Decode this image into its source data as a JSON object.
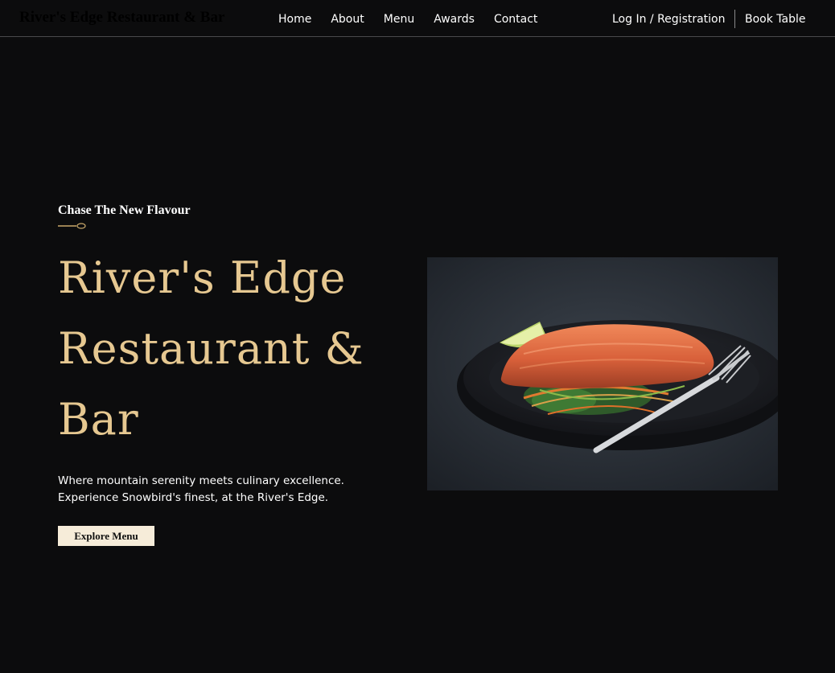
{
  "header": {
    "brand": "River's Edge Restaurant & Bar",
    "nav": [
      "Home",
      "About",
      "Menu",
      "Awards",
      "Contact"
    ],
    "login_label": "Log In / Registration",
    "book_label": "Book Table"
  },
  "hero": {
    "eyebrow": "Chase The New Flavour",
    "title": "River's Edge Restaurant & Bar",
    "tagline_line1": "Where mountain serenity meets culinary excellence.",
    "tagline_line2": "Experience Snowbird's finest, at the River's Edge.",
    "cta_label": "Explore Menu"
  },
  "icons": {
    "divider": "spoon-divider-icon"
  },
  "colors": {
    "background": "#0c0c0d",
    "accent_gold": "#e6c891",
    "button_bg": "#f6ecd9",
    "brand_text": "#000000"
  }
}
